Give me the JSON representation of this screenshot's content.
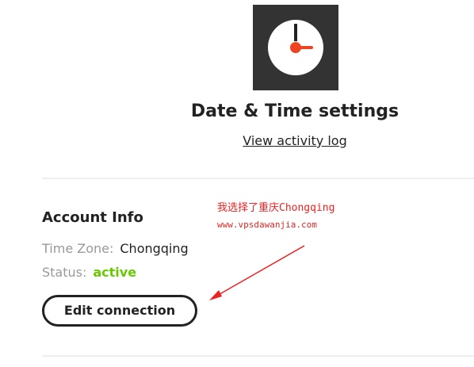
{
  "header": {
    "logo_icon": "clock-icon",
    "title": "Date & Time settings",
    "activity_link_label": "View activity log"
  },
  "account": {
    "section_title": "Account Info",
    "time_zone_label": "Time Zone:",
    "time_zone_value": "Chongqing",
    "status_label": "Status:",
    "status_value": "active",
    "edit_button_label": "Edit connection"
  },
  "annotation": {
    "line1": "我选择了重庆Chongqing",
    "line2": "www.vpsdawanjia.com",
    "color": "#ee2222"
  },
  "colors": {
    "logo_bg": "#333333",
    "logo_accent": "#ee4422",
    "status_active": "#66cc00",
    "text_muted": "#999999",
    "text_primary": "#222222"
  }
}
